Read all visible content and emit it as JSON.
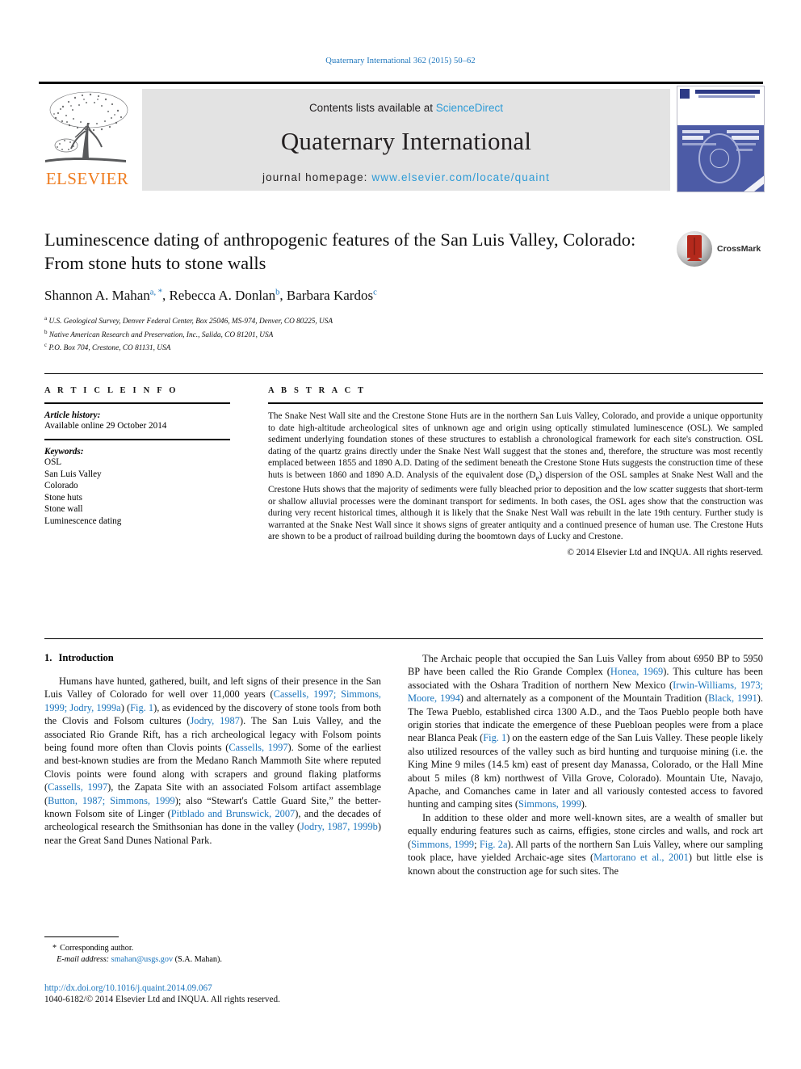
{
  "running_head": "Quaternary International 362 (2015) 50–62",
  "masthead": {
    "contents_prefix": "Contents lists available at ",
    "sciencedirect": "ScienceDirect",
    "journal_title": "Quaternary International",
    "homepage_prefix": "journal homepage: ",
    "homepage_url": "www.elsevier.com/locate/quaint",
    "publisher_logo_text": "ELSEVIER",
    "tree_icon": "tree-icon",
    "cover_thumbnail": "journal-cover-thumbnail"
  },
  "article": {
    "title": "Luminescence dating of anthropogenic features of the San Luis Valley, Colorado: From stone huts to stone walls",
    "crossmark_label": "CrossMark",
    "authors": [
      {
        "name": "Shannon A. Mahan",
        "marks": "a, *"
      },
      {
        "name": "Rebecca A. Donlan",
        "marks": "b"
      },
      {
        "name": "Barbara Kardos",
        "marks": "c"
      }
    ],
    "authors_line": "Shannon A. Mahan a, *, Rebecca A. Donlan b, Barbara Kardos c",
    "affiliations": [
      {
        "key": "a",
        "text": "U.S. Geological Survey, Denver Federal Center, Box 25046, MS-974, Denver, CO 80225, USA"
      },
      {
        "key": "b",
        "text": "Native American Research and Preservation, Inc., Salida, CO 81201, USA"
      },
      {
        "key": "c",
        "text": "P.O. Box 704, Crestone, CO 81131, USA"
      }
    ]
  },
  "article_info": {
    "heading": "A R T I C L E   I N F O",
    "history_label": "Article history:",
    "history_value": "Available online 29 October 2014",
    "keywords_label": "Keywords:",
    "keywords": [
      "OSL",
      "San Luis Valley",
      "Colorado",
      "Stone huts",
      "Stone wall",
      "Luminescence dating"
    ]
  },
  "abstract": {
    "heading": "A B S T R A C T",
    "text": "The Snake Nest Wall site and the Crestone Stone Huts are in the northern San Luis Valley, Colorado, and provide a unique opportunity to date high-altitude archeological sites of unknown age and origin using optically stimulated luminescence (OSL). We sampled sediment underlying foundation stones of these structures to establish a chronological framework for each site's construction. OSL dating of the quartz grains directly under the Snake Nest Wall suggest that the stones and, therefore, the structure was most recently emplaced between 1855 and 1890 A.D. Dating of the sediment beneath the Crestone Stone Huts suggests the construction time of these huts is between 1860 and 1890 A.D. Analysis of the equivalent dose (De) dispersion of the OSL samples at Snake Nest Wall and the Crestone Huts shows that the majority of sediments were fully bleached prior to deposition and the low scatter suggests that short-term or shallow alluvial processes were the dominant transport for sediments. In both cases, the OSL ages show that the construction was during very recent historical times, although it is likely that the Snake Nest Wall was rebuilt in the late 19th century. Further study is warranted at the Snake Nest Wall since it shows signs of greater antiquity and a continued presence of human use. The Crestone Huts are shown to be a product of railroad building during the boomtown days of Lucky and Crestone.",
    "copyright": "© 2014 Elsevier Ltd and INQUA. All rights reserved."
  },
  "body": {
    "section_number": "1.",
    "section_title": "Introduction",
    "left_paragraph_1_parts": [
      {
        "t": "Humans have hunted, gathered, built, and left signs of their presence in the San Luis Valley of Colorado for well over 11,000 years (",
        "link": false
      },
      {
        "t": "Cassells, 1997; Simmons, 1999; Jodry, 1999a",
        "link": true
      },
      {
        "t": ") (",
        "link": false
      },
      {
        "t": "Fig. 1",
        "link": true
      },
      {
        "t": "), as evidenced by the discovery of stone tools from both the Clovis and Folsom cultures (",
        "link": false
      },
      {
        "t": "Jodry, 1987",
        "link": true
      },
      {
        "t": "). The San Luis Valley, and the associated Rio Grande Rift, has a rich archeological legacy with Folsom points being found more often than Clovis points (",
        "link": false
      },
      {
        "t": "Cassells, 1997",
        "link": true
      },
      {
        "t": "). Some of the earliest and best-known studies are from the Medano Ranch Mammoth Site where reputed Clovis points were found along with scrapers and ground flaking platforms (",
        "link": false
      },
      {
        "t": "Cassells, 1997",
        "link": true
      },
      {
        "t": "), the Zapata Site with an associated Folsom artifact assemblage (",
        "link": false
      },
      {
        "t": "Button, 1987; Simmons, 1999",
        "link": true
      },
      {
        "t": "); also “Stewart's Cattle Guard Site,” the better-known Folsom site of Linger (",
        "link": false
      },
      {
        "t": "Pitblado and Brunswick, 2007",
        "link": true
      },
      {
        "t": "), and the decades of archeological research the Smithsonian has done in the valley (",
        "link": false
      },
      {
        "t": "Jodry, 1987, 1999b",
        "link": true
      },
      {
        "t": ") near the Great Sand Dunes National Park.",
        "link": false
      }
    ],
    "right_paragraph_1_parts": [
      {
        "t": "The Archaic people that occupied the San Luis Valley from about 6950 BP to 5950 BP have been called the Rio Grande Complex (",
        "link": false
      },
      {
        "t": "Honea, 1969",
        "link": true
      },
      {
        "t": "). This culture has been associated with the Oshara Tradition of northern New Mexico (",
        "link": false
      },
      {
        "t": "Irwin-Williams, 1973; Moore, 1994",
        "link": true
      },
      {
        "t": ") and alternately as a component of the Mountain Tradition (",
        "link": false
      },
      {
        "t": "Black, 1991",
        "link": true
      },
      {
        "t": "). The Tewa Pueblo, established circa 1300 A.D., and the Taos Pueblo people both have origin stories that indicate the emergence of these Puebloan peoples were from a place near Blanca Peak (",
        "link": false
      },
      {
        "t": "Fig. 1",
        "link": true
      },
      {
        "t": ") on the eastern edge of the San Luis Valley. These people likely also utilized resources of the valley such as bird hunting and turquoise mining (i.e. the King Mine 9 miles (14.5 km) east of present day Manassa, Colorado, or the Hall Mine about 5 miles (8 km) northwest of Villa Grove, Colorado). Mountain Ute, Navajo, Apache, and Comanches came in later and all variously contested access to favored hunting and camping sites (",
        "link": false
      },
      {
        "t": "Simmons, 1999",
        "link": true
      },
      {
        "t": ").",
        "link": false
      }
    ],
    "right_paragraph_2_parts": [
      {
        "t": "In addition to these older and more well-known sites, are a wealth of smaller but equally enduring features such as cairns, effigies, stone circles and walls, and rock art (",
        "link": false
      },
      {
        "t": "Simmons, 1999",
        "link": true
      },
      {
        "t": "; ",
        "link": false
      },
      {
        "t": "Fig. 2a",
        "link": true
      },
      {
        "t": "). All parts of the northern San Luis Valley, where our sampling took place, have yielded Archaic-age sites (",
        "link": false
      },
      {
        "t": "Martorano et al., 2001",
        "link": true
      },
      {
        "t": ") but little else is known about the construction age for such sites. The",
        "link": false
      }
    ]
  },
  "footer": {
    "corresponding_star": "*",
    "corresponding_text": "Corresponding author.",
    "email_label": "E-mail address:",
    "email_value": "smahan@usgs.gov",
    "email_suffix": "(S.A. Mahan).",
    "doi": "http://dx.doi.org/10.1016/j.quaint.2014.09.067",
    "issn_line": "1040-6182/© 2014 Elsevier Ltd and INQUA. All rights reserved."
  },
  "colors": {
    "link_blue": "#1c75bc",
    "sciencedirect_blue": "#2e9bd6",
    "elsevier_orange": "#ef7d21",
    "band_gray": "#e3e3e3",
    "crossmark_red": "#b4291c"
  }
}
